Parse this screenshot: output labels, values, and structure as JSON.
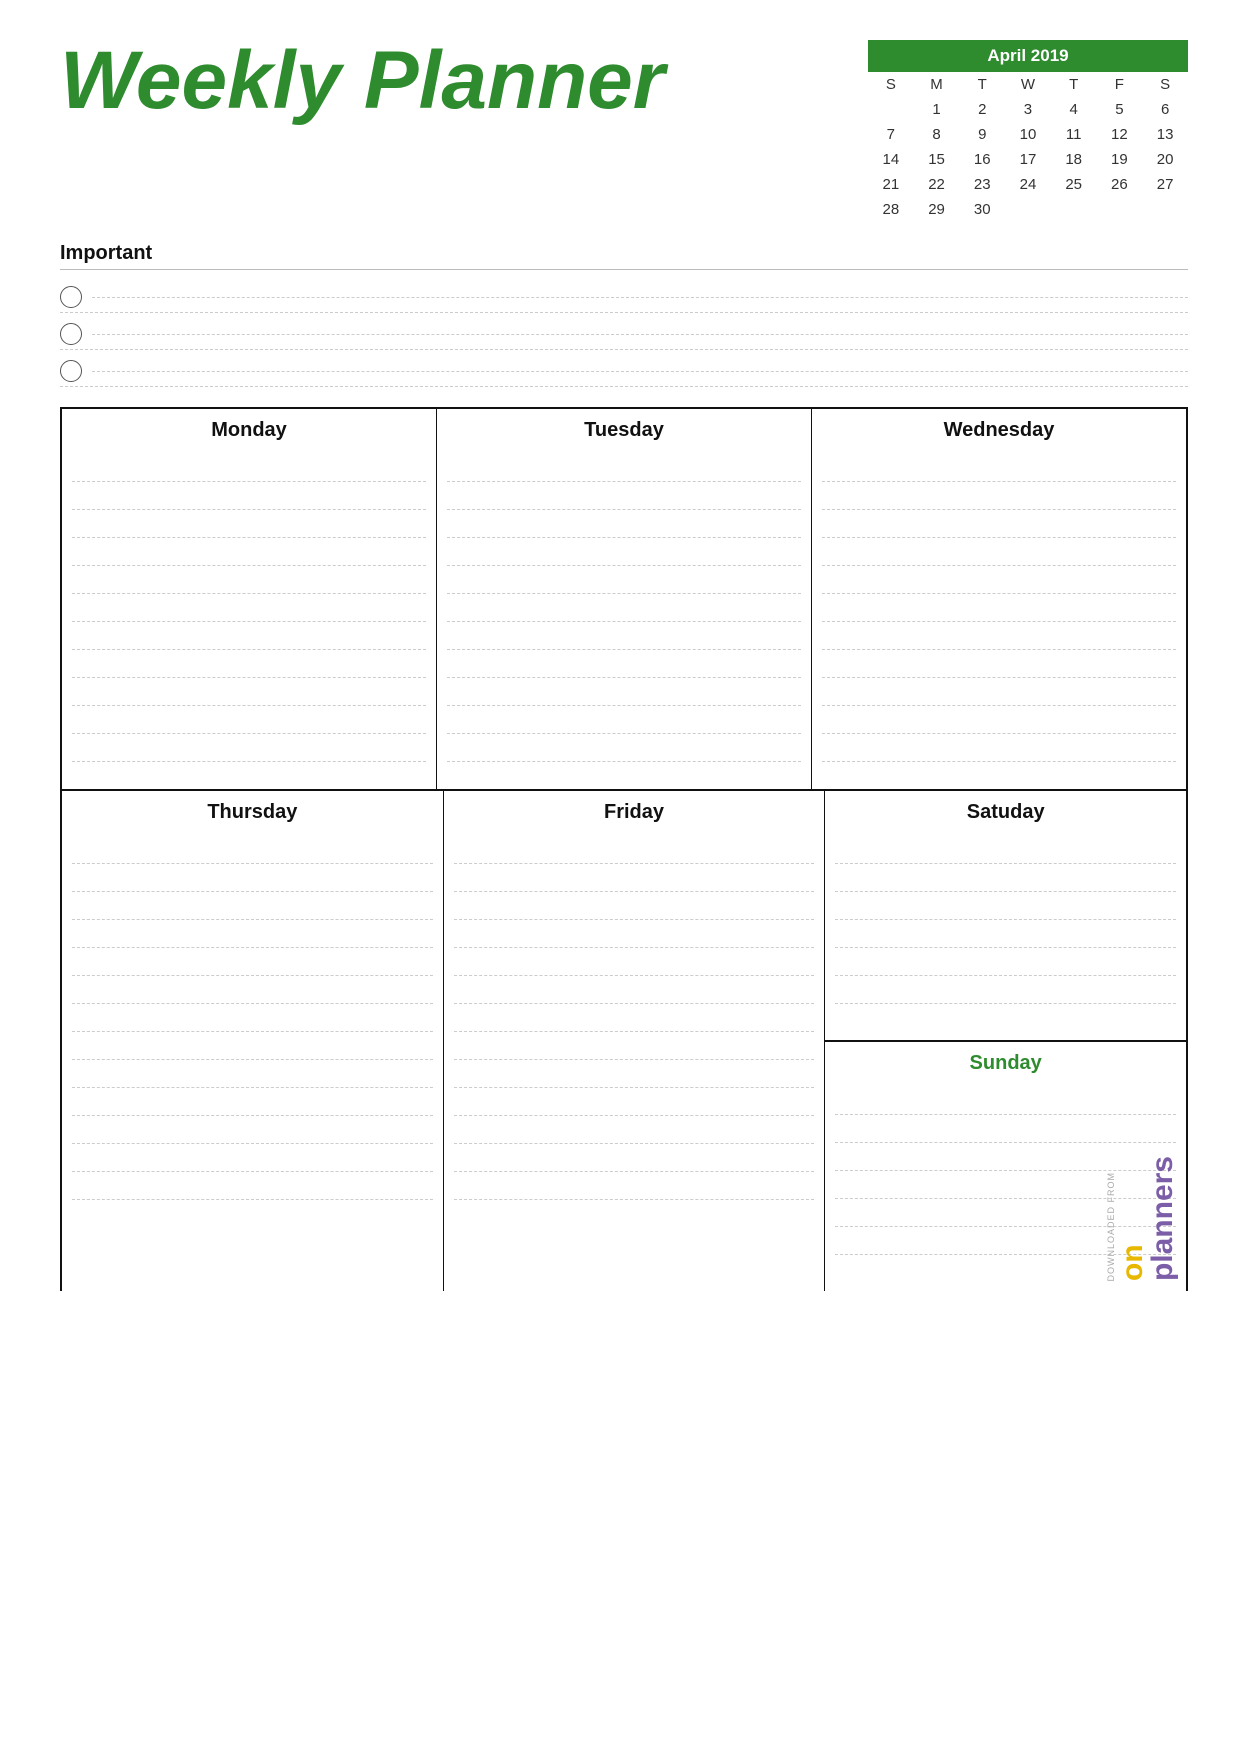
{
  "title": "Weekly Planner",
  "calendar": {
    "month_year": "April 2019",
    "day_headers": [
      "S",
      "M",
      "T",
      "W",
      "T",
      "F",
      "S"
    ],
    "weeks": [
      [
        "",
        "",
        "",
        "",
        "",
        "1",
        "2",
        "3",
        "4",
        "5",
        "6"
      ],
      [
        "7",
        "8",
        "9",
        "10",
        "11",
        "12",
        "13"
      ],
      [
        "14",
        "15",
        "16",
        "17",
        "18",
        "19",
        "20"
      ],
      [
        "21",
        "22",
        "23",
        "24",
        "25",
        "26",
        "27"
      ],
      [
        "28",
        "29",
        "30",
        "",
        "",
        "",
        ""
      ]
    ]
  },
  "important": {
    "label": "Important",
    "items": [
      "",
      "",
      ""
    ]
  },
  "days": {
    "monday": "Monday",
    "tuesday": "Tuesday",
    "wednesday": "Wednesday",
    "thursday": "Thursday",
    "friday": "Friday",
    "satuday": "Satuday",
    "sunday": "Sunday"
  },
  "watermark": {
    "downloaded_from": "DOWNLOADED FROM",
    "brand_on": "on",
    "brand_planners": "planners"
  }
}
